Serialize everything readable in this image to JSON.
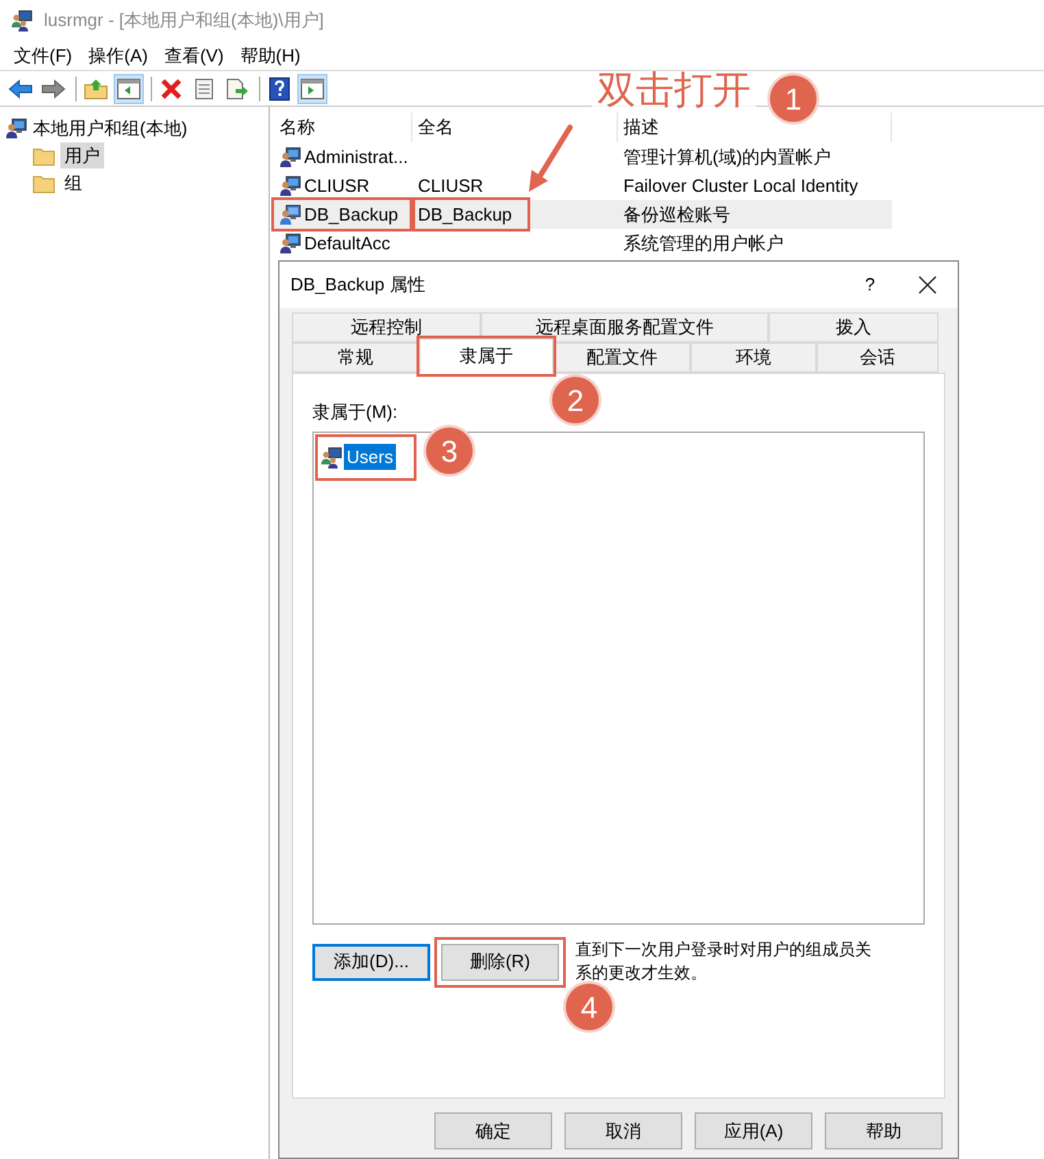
{
  "window": {
    "title": "lusrmgr - [本地用户和组(本地)\\用户]"
  },
  "menu": [
    "文件(F)",
    "操作(A)",
    "查看(V)",
    "帮助(H)"
  ],
  "toolbar": [
    {
      "kind": "back",
      "pressed": false
    },
    {
      "kind": "forward",
      "pressed": false
    },
    {
      "kind": "up",
      "pressed": false
    },
    {
      "kind": "tree",
      "pressed": true
    },
    {
      "kind": "delete",
      "pressed": false
    },
    {
      "kind": "properties",
      "pressed": false
    },
    {
      "kind": "export",
      "pressed": false
    },
    {
      "kind": "help",
      "pressed": false
    },
    {
      "kind": "action",
      "pressed": true
    }
  ],
  "tree": {
    "label": "本地用户和组(本地)",
    "children": [
      {
        "label": "用户",
        "selected": true
      },
      {
        "label": "组",
        "selected": false
      }
    ]
  },
  "list": {
    "columns": [
      "名称",
      "全名",
      "描述"
    ],
    "rows": [
      {
        "name": "Administrat...",
        "description": "管理计算机(域)的内置帐户",
        "selected": false,
        "disabled": false
      },
      {
        "name": "CLIUSR",
        "full_name": "CLIUSR",
        "description": "Failover Cluster Local Identity",
        "selected": false,
        "disabled": false
      },
      {
        "name": "DB_Backup",
        "full_name": "DB_Backup",
        "description": "备份巡检账号",
        "selected": true,
        "disabled": true
      },
      {
        "name": "DefaultAcc",
        "description": "系统管理的用户帐户",
        "selected": false,
        "disabled": false
      }
    ]
  },
  "dialog": {
    "title": "DB_Backup 属性",
    "help": "?",
    "tab_rows": [
      [
        {
          "label": "远程控制",
          "selected": false
        },
        {
          "label": "远程桌面服务配置文件",
          "selected": false
        },
        {
          "label": "拨入",
          "selected": false
        }
      ],
      [
        {
          "label": "常规",
          "selected": false
        },
        {
          "label": "隶属于",
          "selected": true
        },
        {
          "label": "配置文件",
          "selected": false
        },
        {
          "label": "环境",
          "selected": false
        },
        {
          "label": "会话",
          "selected": false
        }
      ]
    ],
    "member_label": "隶属于(M):",
    "members": [
      {
        "label": "Users",
        "selected": true
      }
    ],
    "add_button": "添加(D)...",
    "remove_button": "删除(R)",
    "note": "直到下一次用户登录时对用户的组成员关系的更改才生效。",
    "buttons": [
      "确定",
      "取消",
      "应用(A)",
      "帮助"
    ]
  },
  "annotations": {
    "hint": "双击打开",
    "steps": [
      "1",
      "2",
      "3",
      "4"
    ]
  }
}
